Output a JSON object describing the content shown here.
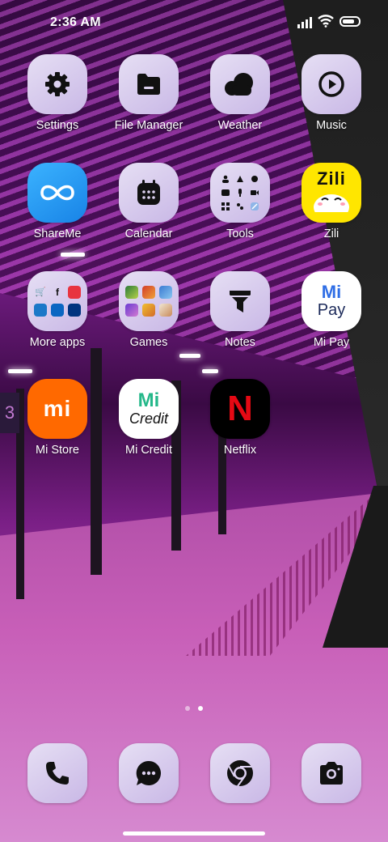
{
  "status_bar": {
    "time": "2:36 AM"
  },
  "apps": {
    "settings": "Settings",
    "file_manager": "File Manager",
    "weather": "Weather",
    "music": "Music",
    "shareme": "ShareMe",
    "calendar": "Calendar",
    "tools": "Tools",
    "zili": "Zili",
    "more_apps": "More apps",
    "games": "Games",
    "notes": "Notes",
    "mi_pay": "Mi Pay",
    "mi_store": "Mi Store",
    "mi_credit": "Mi Credit",
    "netflix": "Netflix"
  },
  "icon_text": {
    "zili": "Zili",
    "mi_pay_top": "Mi",
    "mi_pay_bottom": "Pay",
    "mi_store": "mi",
    "mi_credit_top": "Mi",
    "mi_credit_bottom": "Credit",
    "netflix": "N",
    "wallpaper_sign": "3"
  },
  "page_indicator": {
    "pages": 2,
    "active": 2
  },
  "dock": [
    "phone-icon",
    "messages-icon",
    "chrome-icon",
    "camera-icon"
  ],
  "colors": {
    "shareme_blue": "#1e9bf0",
    "zili_yellow": "#ffe600",
    "mi_orange": "#ff6900",
    "netflix_red": "#e50914",
    "mi_credit_green": "#25b88a",
    "mi_pay_blue": "#2f6ee5"
  }
}
